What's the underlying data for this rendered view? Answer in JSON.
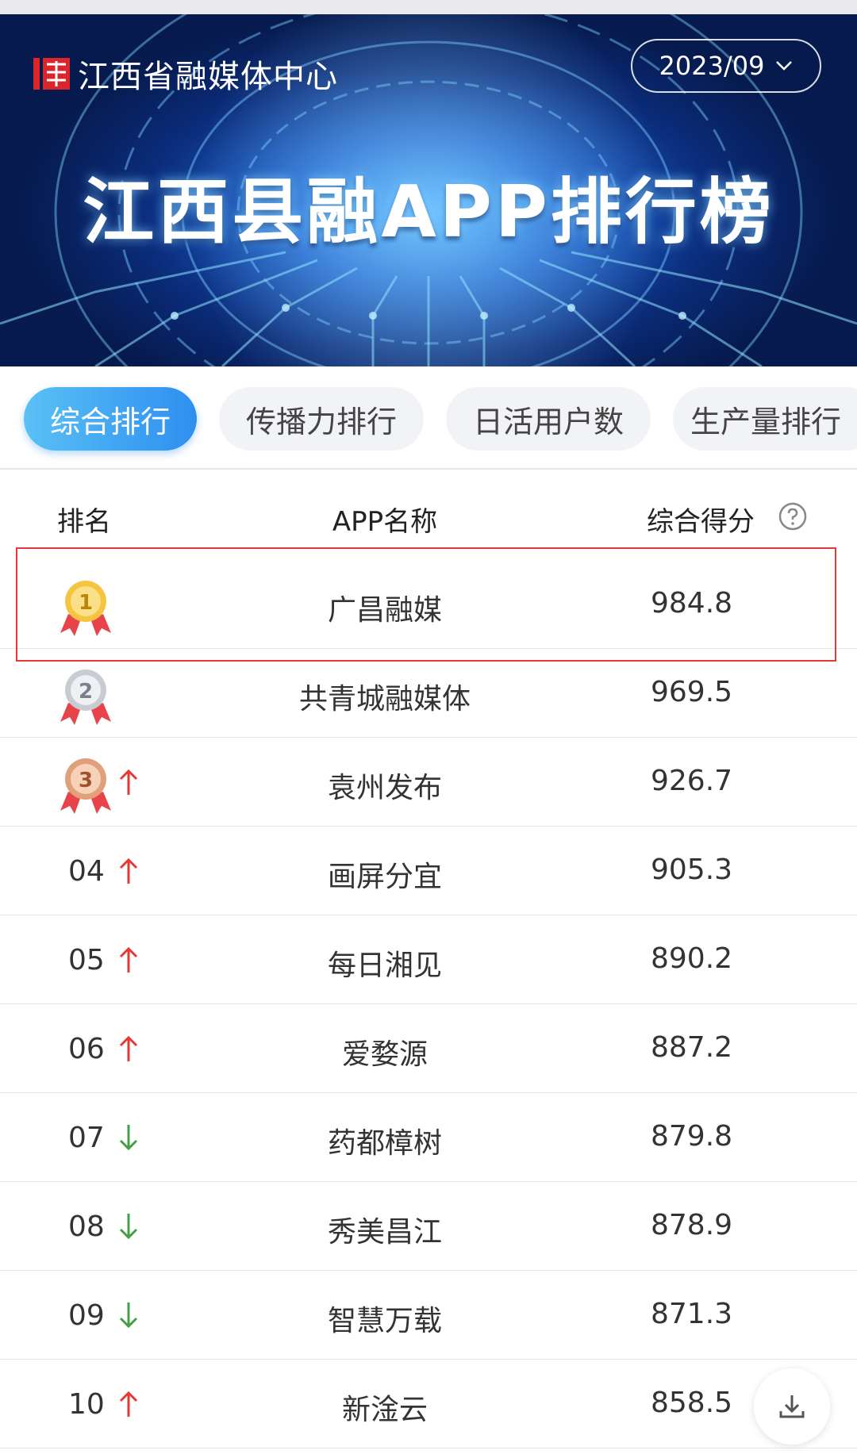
{
  "header": {
    "logo_text": "江西省融媒体中心",
    "date": "2023/09",
    "title": "江西县融APP排行榜"
  },
  "tabs": [
    {
      "label": "综合排行",
      "active": true
    },
    {
      "label": "传播力排行",
      "active": false
    },
    {
      "label": "日活用户数",
      "active": false
    },
    {
      "label": "生产量排行",
      "active": false
    }
  ],
  "table": {
    "headers": {
      "rank": "排名",
      "app": "APP名称",
      "score": "综合得分"
    },
    "rows": [
      {
        "rank": "01",
        "medal": "gold",
        "trend": "none",
        "app": "广昌融媒",
        "score": "984.8"
      },
      {
        "rank": "02",
        "medal": "silver",
        "trend": "none",
        "app": "共青城融媒体",
        "score": "969.5"
      },
      {
        "rank": "03",
        "medal": "bronze",
        "trend": "up",
        "app": "袁州发布",
        "score": "926.7"
      },
      {
        "rank": "04",
        "medal": "none",
        "trend": "up",
        "app": "画屏分宜",
        "score": "905.3"
      },
      {
        "rank": "05",
        "medal": "none",
        "trend": "up",
        "app": "每日湘见",
        "score": "890.2"
      },
      {
        "rank": "06",
        "medal": "none",
        "trend": "up",
        "app": "爱婺源",
        "score": "887.2"
      },
      {
        "rank": "07",
        "medal": "none",
        "trend": "down",
        "app": "药都樟树",
        "score": "879.8"
      },
      {
        "rank": "08",
        "medal": "none",
        "trend": "down",
        "app": "秀美昌江",
        "score": "878.9"
      },
      {
        "rank": "09",
        "medal": "none",
        "trend": "down",
        "app": "智慧万载",
        "score": "871.3"
      },
      {
        "rank": "10",
        "medal": "none",
        "trend": "up",
        "app": "新淦云",
        "score": "858.5"
      }
    ]
  },
  "colors": {
    "up": "#e53935",
    "down": "#43a047",
    "accent": "#2e8ff0",
    "highlight": "#e53935"
  }
}
